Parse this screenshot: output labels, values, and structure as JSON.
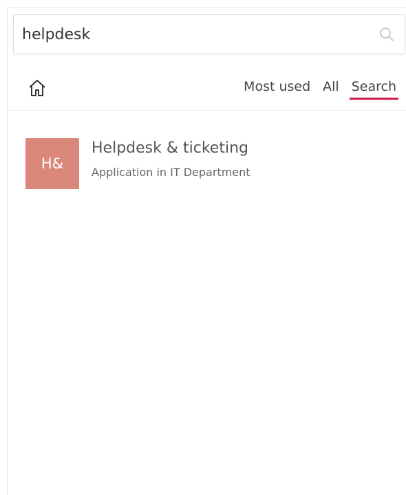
{
  "search": {
    "value": "helpdesk",
    "icon": "search-icon"
  },
  "nav": {
    "home_icon": "home-icon",
    "tabs": [
      {
        "label": "Most used",
        "active": false
      },
      {
        "label": "All",
        "active": false
      },
      {
        "label": "Search",
        "active": true
      }
    ],
    "active_color": "#d01848"
  },
  "results": [
    {
      "tile_text": "H&",
      "tile_color": "#d9887a",
      "title": "Helpdesk & ticketing",
      "subtitle": "Application in IT Department"
    }
  ]
}
